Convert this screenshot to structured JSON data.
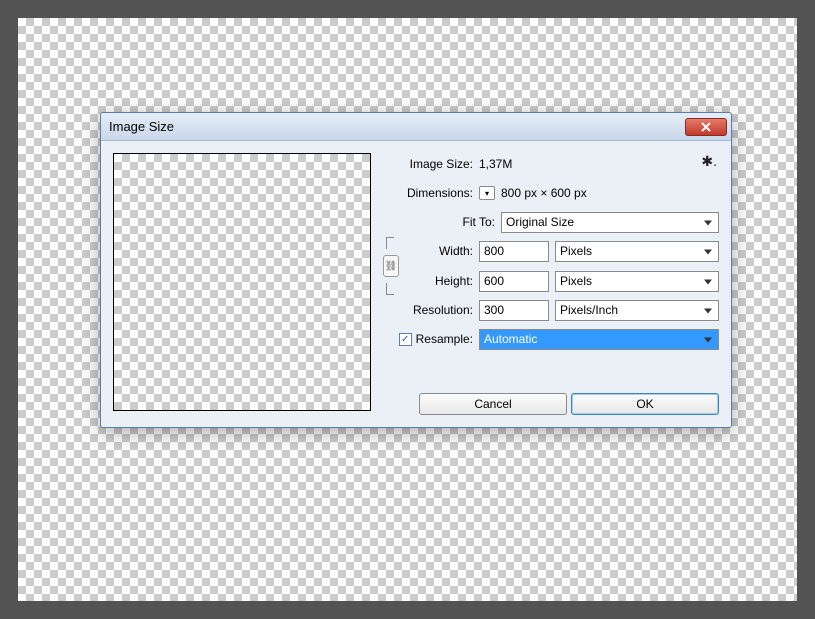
{
  "dialog": {
    "title": "Image Size",
    "sizeLabel": "Image Size:",
    "sizeValue": "1,37M",
    "dimensionsLabel": "Dimensions:",
    "dimensionsValue": "800 px  ×  600 px",
    "fitToLabel": "Fit To:",
    "fitToValue": "Original Size",
    "widthLabel": "Width:",
    "widthValue": "800",
    "widthUnit": "Pixels",
    "heightLabel": "Height:",
    "heightValue": "600",
    "heightUnit": "Pixels",
    "resolutionLabel": "Resolution:",
    "resolutionValue": "300",
    "resolutionUnit": "Pixels/Inch",
    "resampleLabel": "Resample:",
    "resampleChecked": true,
    "resampleMethod": "Automatic",
    "cancelLabel": "Cancel",
    "okLabel": "OK"
  }
}
